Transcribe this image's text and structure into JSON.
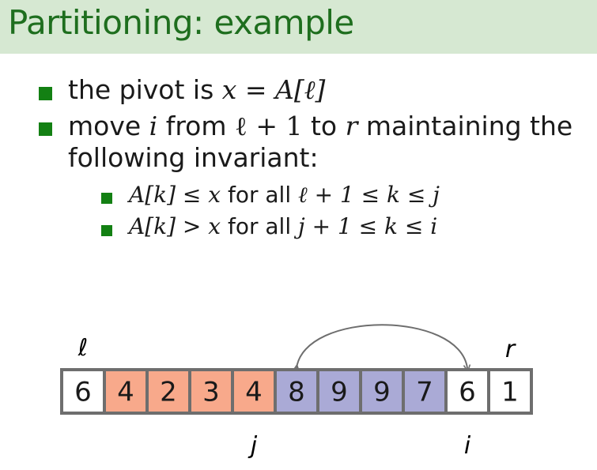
{
  "title": "Partitioning: example",
  "bullets": {
    "b1": {
      "text_a": "the pivot is ",
      "math": "x = A[ℓ]"
    },
    "b2": {
      "text_a": "move ",
      "var_i": "i",
      "text_b": " from ",
      "math_from": "ℓ + 1",
      "text_c": " to ",
      "var_r": "r",
      "text_d": " maintaining the",
      "line2": "following invariant:"
    },
    "sub1": {
      "math_a": "A[k] ≤ x",
      "text": " for all ",
      "math_b": "ℓ + 1 ≤ k ≤ j"
    },
    "sub2": {
      "math_a": "A[k] > x",
      "text": " for all ",
      "math_b": "j + 1 ≤ k ≤ i"
    }
  },
  "array": {
    "cells": [
      {
        "value": "6",
        "group": "pivot"
      },
      {
        "value": "4",
        "group": "le"
      },
      {
        "value": "2",
        "group": "le"
      },
      {
        "value": "3",
        "group": "le"
      },
      {
        "value": "4",
        "group": "le"
      },
      {
        "value": "8",
        "group": "gt"
      },
      {
        "value": "9",
        "group": "gt"
      },
      {
        "value": "9",
        "group": "gt"
      },
      {
        "value": "7",
        "group": "gt"
      },
      {
        "value": "6",
        "group": "unprocessed"
      },
      {
        "value": "1",
        "group": "unprocessed"
      }
    ],
    "colors": {
      "pivot": "#ffffff",
      "le": "#f8a98b",
      "gt": "#aaaad6",
      "unprocessed": "#ffffff",
      "border": "#6e6e6e",
      "arrow": "#6e6e6e"
    },
    "labels": {
      "ell": "ℓ",
      "r": "r",
      "j": "j",
      "i": "i"
    },
    "swap_arrow": {
      "from_cell": 5,
      "to_cell": 9
    }
  }
}
